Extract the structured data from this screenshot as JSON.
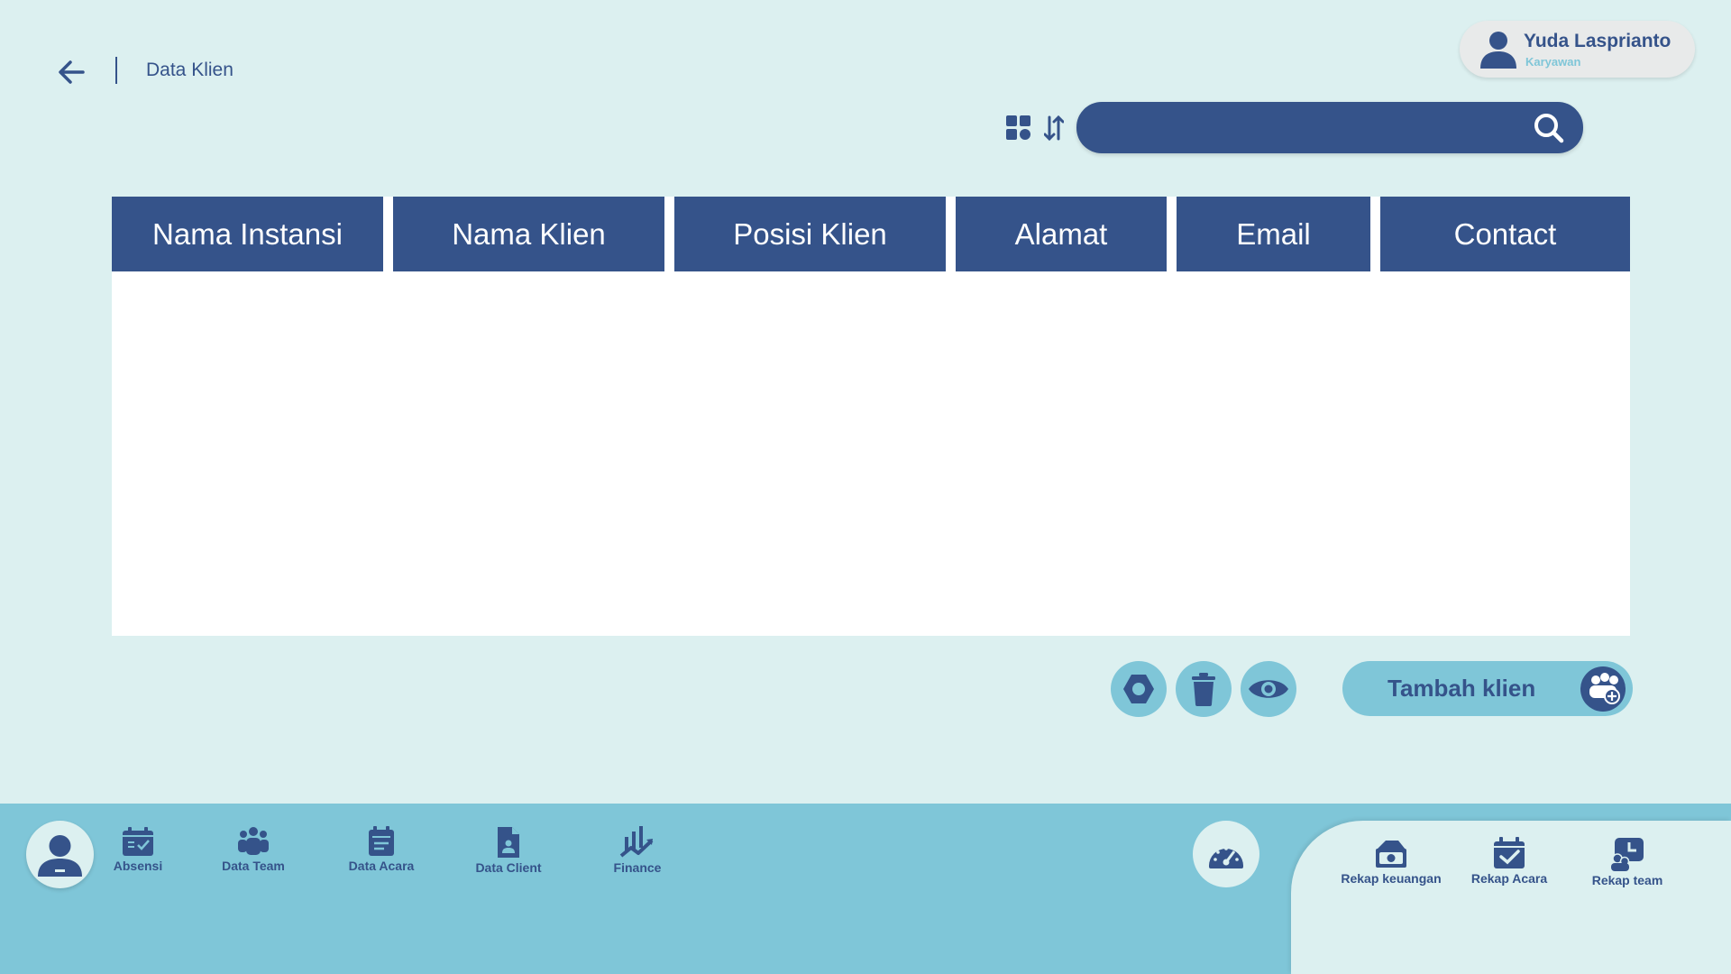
{
  "header": {
    "title": "Data Klien"
  },
  "user": {
    "name": "Yuda Lasprianto",
    "role": "Karyawan"
  },
  "search": {
    "value": "",
    "placeholder": ""
  },
  "table": {
    "columns": [
      "Nama Instansi",
      "Nama Klien",
      "Posisi Klien",
      "Alamat",
      "Email",
      "Contact"
    ],
    "rows": []
  },
  "actions": {
    "add_label": "Tambah klien"
  },
  "nav": {
    "items": [
      {
        "label": "Absensi",
        "icon": "calendar-check-icon"
      },
      {
        "label": "Data Team",
        "icon": "team-icon"
      },
      {
        "label": "Data Acara",
        "icon": "calendar-list-icon"
      },
      {
        "label": "Data Client",
        "icon": "document-person-icon"
      },
      {
        "label": "Finance",
        "icon": "chart-icon"
      }
    ],
    "rekap": [
      {
        "label": "Rekap keuangan",
        "icon": "money-box-icon"
      },
      {
        "label": "Rekap Acara",
        "icon": "calendar-check-icon"
      },
      {
        "label": "Rekap team",
        "icon": "team-clock-icon"
      }
    ]
  },
  "colors": {
    "primary": "#35538a",
    "accent": "#7fc6d8",
    "background": "#dcf0f0",
    "table_body": "#ffffff"
  }
}
